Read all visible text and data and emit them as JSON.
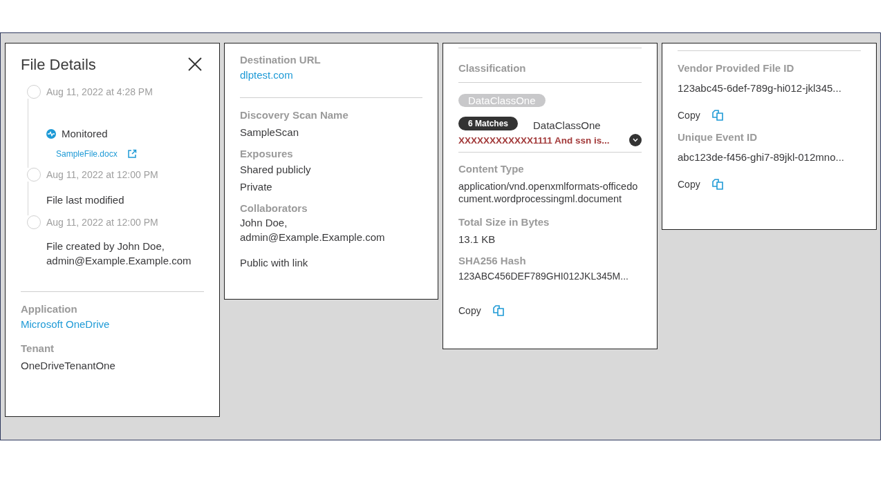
{
  "file_details": {
    "title": "File Details",
    "timeline": [
      {
        "kind": "status",
        "time": "Aug 11, 2022 at 4:28 PM",
        "status": "Monitored",
        "file": "SampleFile.docx"
      },
      {
        "kind": "text",
        "time": "Aug 11, 2022 at 12:00 PM",
        "text": "File last modified"
      },
      {
        "kind": "text",
        "time": "Aug 11, 2022 at 12:00 PM",
        "text": "File created by John Doe, admin@Example.Example.com"
      }
    ],
    "application": {
      "label": "Application",
      "value": "Microsoft OneDrive"
    },
    "tenant": {
      "label": "Tenant",
      "value": "OneDriveTenantOne"
    }
  },
  "scan": {
    "destination": {
      "label": "Destination URL",
      "value": "dlptest.com"
    },
    "scan_name": {
      "label": "Discovery Scan Name",
      "value": "SampleScan"
    },
    "exposures": {
      "label": "Exposures",
      "values": [
        "Shared publicly",
        "Private"
      ]
    },
    "collaborators": {
      "label": "Collaborators",
      "value": "John Doe, admin@Example.Example.com"
    },
    "link_sharing": "Public with link"
  },
  "content": {
    "classification": {
      "label": "Classification",
      "tag": "DataClassOne",
      "matches": "6 Matches",
      "class_name": "DataClassOne",
      "snippet": "XXXXXXXXXXXX1111 And ssn is...",
      "expanded": false
    },
    "content_type": {
      "label": "Content Type",
      "value": "application/vnd.openxmlformats-officedocument.wordprocessingml.document"
    },
    "size": {
      "label": "Total Size in Bytes",
      "value": "13.1 KB"
    },
    "hash": {
      "label": "SHA256 Hash",
      "value": "123ABC456DEF789GHI012JKL345M...",
      "copy": "Copy"
    }
  },
  "ids": [
    {
      "label": "Vendor Provided File ID",
      "value": "123abc45-6def-789g-hi012-jkl345...",
      "copy": "Copy"
    },
    {
      "label": "Unique Event ID",
      "value": "abc123de-f456-ghi7-89jkl-012mno...",
      "copy": "Copy"
    }
  ]
}
